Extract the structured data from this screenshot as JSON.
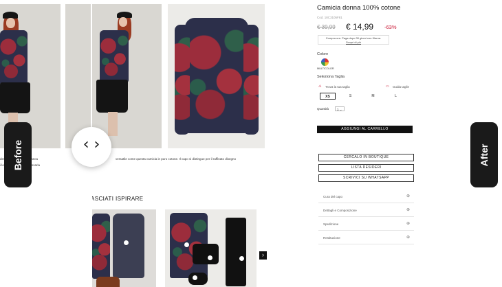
{
  "product": {
    "title": "Camicia donna 100% cotone",
    "code": "Cod. 18C3105F81",
    "old_price": "€ 39,99",
    "price": "€ 14,99",
    "discount": "-63%",
    "klarna_line1": "Compra ora. Paga dopo 30 giorni con Klarna.",
    "klarna_line2": "Scopri di più"
  },
  "color": {
    "label": "Colore",
    "value": "MULTICOLOR"
  },
  "size": {
    "label": "Seleziona Taglia",
    "find_size": "Trova la tua taglia",
    "size_guide": "Guida taglie",
    "options": [
      "XS",
      "S",
      "M",
      "L"
    ],
    "selected": "XS"
  },
  "quantity": {
    "label": "Quantità",
    "value": "1 ⌄"
  },
  "buttons": {
    "add_to_cart": "AGGIUNGI AL CARRELLO",
    "boutique": "CERCALO IN BOUTIQUE",
    "wishlist": "LISTA DESIDERI",
    "whatsapp": "SCRIVICI SU WHATSAPP"
  },
  "accordion": [
    "Cura del capo",
    "Dettagli e Composizione",
    "Spedizione",
    "Restituzione"
  ],
  "description": {
    "left": "deve assolutamente manca",
    "right": "versatile come questa camicia in puro cotone. Il capo si distingue per il raffinato disegno",
    "left2": "i lo rendono perfetto in svaria"
  },
  "inspire": {
    "heading": "ASCIATI ISPIRARE"
  },
  "compare": {
    "before": "Before",
    "after": "After",
    "handle": "‹ ›"
  },
  "carousel": {
    "next": "›"
  }
}
